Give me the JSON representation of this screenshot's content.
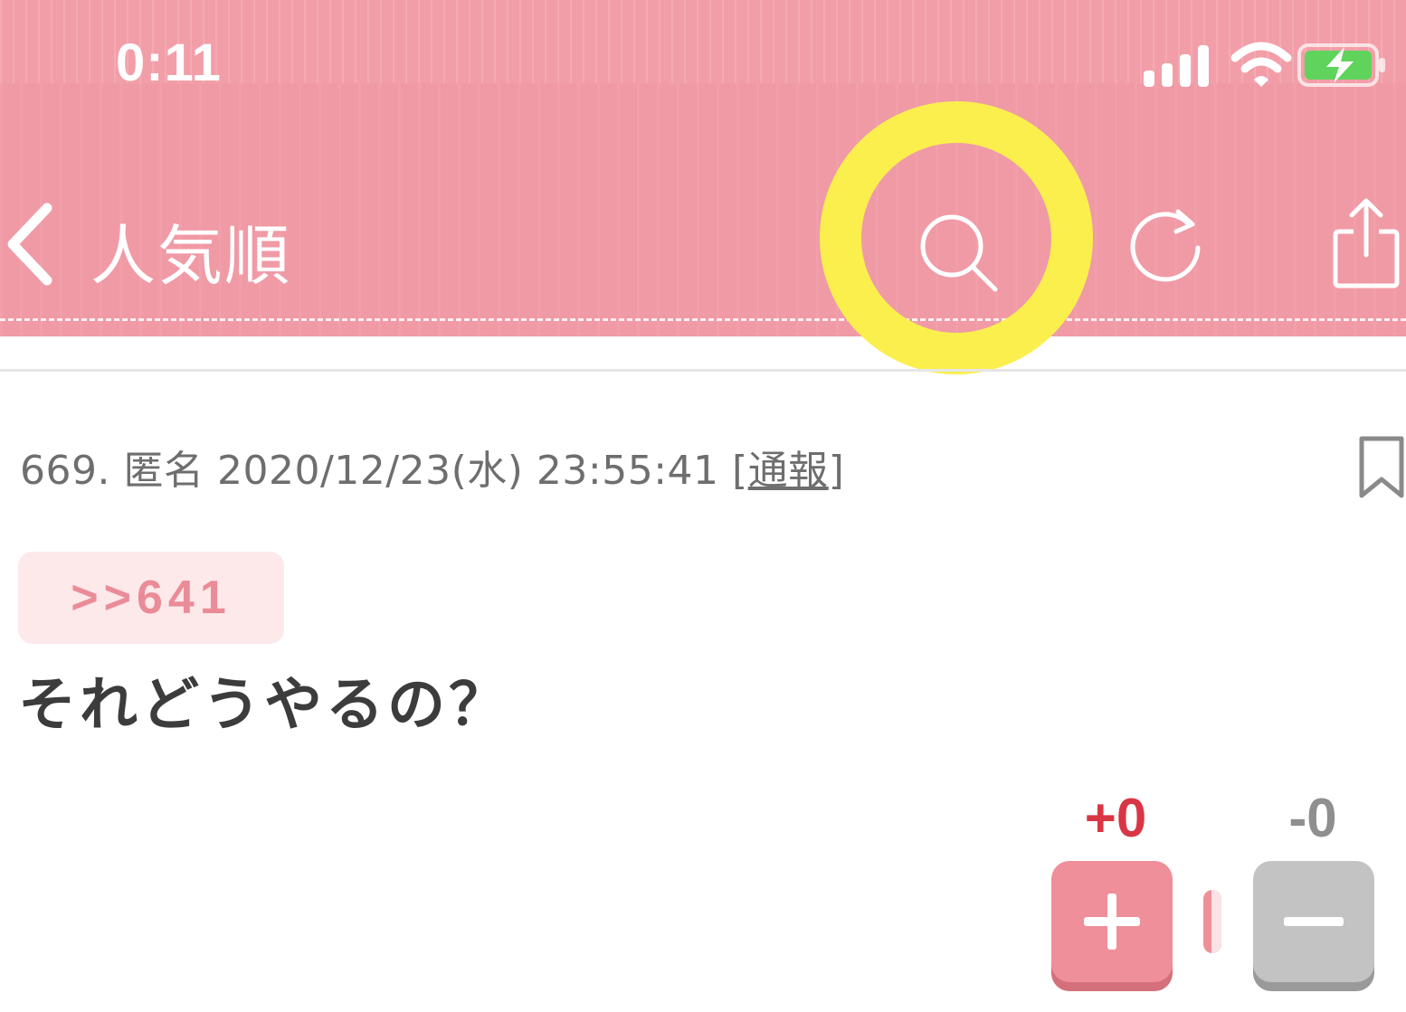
{
  "status_bar": {
    "time": "0:11"
  },
  "header": {
    "title": "人気順",
    "icons": [
      "chevron-left-icon",
      "search-icon",
      "refresh-icon",
      "share-icon"
    ]
  },
  "post": {
    "number": "669.",
    "author": "匿名",
    "datetime": "2020/12/23(水) 23:55:41",
    "report_open": "[",
    "report_label": "通報",
    "report_close": "]",
    "reply_ref": ">>641",
    "body": "それどうやるの？"
  },
  "votes": {
    "plus_count": "+0",
    "minus_count": "-0"
  },
  "colors": {
    "header": "#f09aa5",
    "highlight": "#fbef4e",
    "plus": "#d93645",
    "minus": "#8f8f8f"
  }
}
